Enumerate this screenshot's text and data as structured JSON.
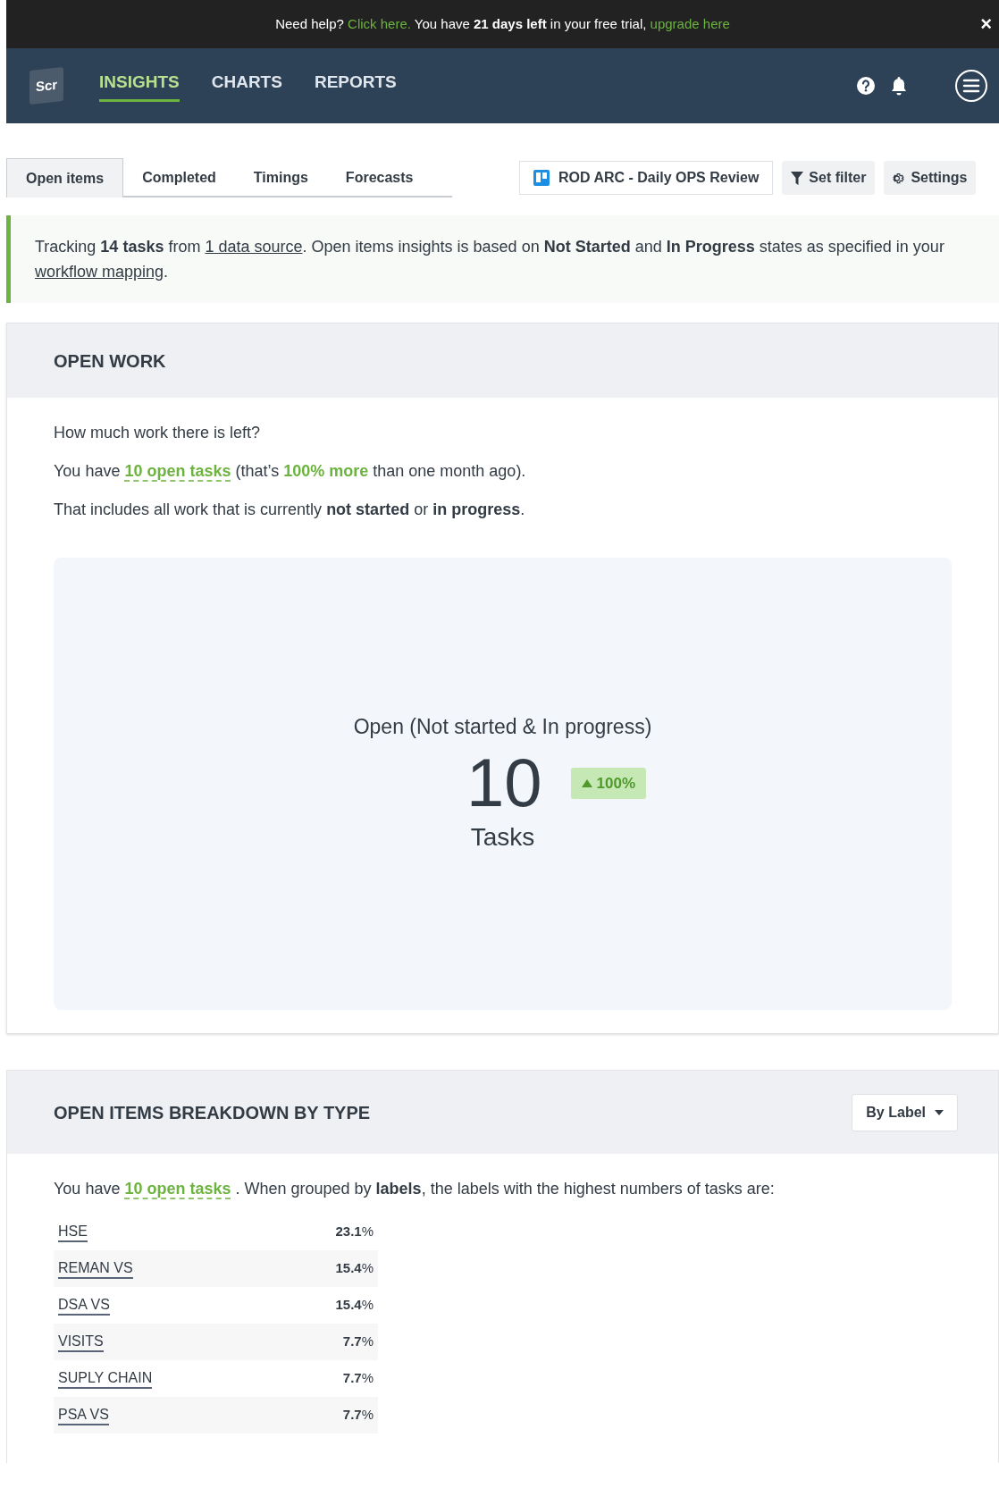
{
  "banner": {
    "segments": [
      {
        "kind": "text",
        "text": "Need help? "
      },
      {
        "kind": "link",
        "text": "Click here."
      },
      {
        "kind": "text",
        "text": " You have **21 days left** in your free trial, "
      },
      {
        "kind": "link",
        "text": "upgrade here"
      }
    ],
    "close": "×"
  },
  "nav": {
    "logo": "Scr",
    "items": [
      {
        "label": "INSIGHTS",
        "selected": true
      },
      {
        "label": "CHARTS",
        "selected": false
      },
      {
        "label": "REPORTS",
        "selected": false
      }
    ]
  },
  "tabs": [
    {
      "label": "Open items",
      "selected": true
    },
    {
      "label": "Completed",
      "selected": false
    },
    {
      "label": "Timings",
      "selected": false
    },
    {
      "label": "Forecasts",
      "selected": false
    }
  ],
  "toolbar": {
    "board": "ROD ARC - Daily OPS Review",
    "filter": "Set filter",
    "settings": "Settings"
  },
  "info": {
    "segments": [
      {
        "kind": "text",
        "text": "Tracking **14 tasks** from "
      },
      {
        "kind": "link",
        "text": "1 data source"
      },
      {
        "kind": "text",
        "text": ". Open items insights is based on **Not Started** and **In Progress** states as specified in your "
      },
      {
        "kind": "link",
        "text": "workflow mapping"
      },
      {
        "kind": "text",
        "text": "."
      }
    ]
  },
  "open_work": {
    "title": "OPEN WORK",
    "paragraphs": [
      [
        {
          "kind": "text",
          "text": "How much work there is left?"
        }
      ],
      [
        {
          "kind": "text",
          "text": "You have "
        },
        {
          "kind": "link",
          "text": "10 open tasks"
        },
        {
          "kind": "text",
          "text": " (that’s "
        },
        {
          "kind": "highlight",
          "text": "100% more"
        },
        {
          "kind": "text",
          "text": " than one month ago)."
        }
      ],
      [
        {
          "kind": "text",
          "text": "That includes all work that is currently **not started** or **in progress**."
        }
      ]
    ],
    "stat": {
      "title": "Open (Not started & In progress)",
      "value": "10",
      "unit": "Tasks",
      "change": "100%",
      "increase": true
    }
  },
  "breakdown": {
    "title": "OPEN ITEMS BREAKDOWN BY TYPE",
    "dropdown": "By Label",
    "intro": [
      {
        "kind": "text",
        "text": "You have "
      },
      {
        "kind": "link",
        "text": "10 open tasks"
      },
      {
        "kind": "text",
        "text": " . When grouped by **labels**, the labels with the highest numbers of tasks are:"
      }
    ],
    "rows": [
      {
        "label": "HSE",
        "percent": "**23.1**%"
      },
      {
        "label": "REMAN VS",
        "percent": "**15.4**%"
      },
      {
        "label": "DSA VS",
        "percent": "**15.4**%"
      },
      {
        "label": "VISITS",
        "percent": "**7.7**%"
      },
      {
        "label": "SUPLY CHAIN",
        "percent": "**7.7**%"
      },
      {
        "label": "PSA VS",
        "percent": "**7.7**%"
      }
    ]
  }
}
